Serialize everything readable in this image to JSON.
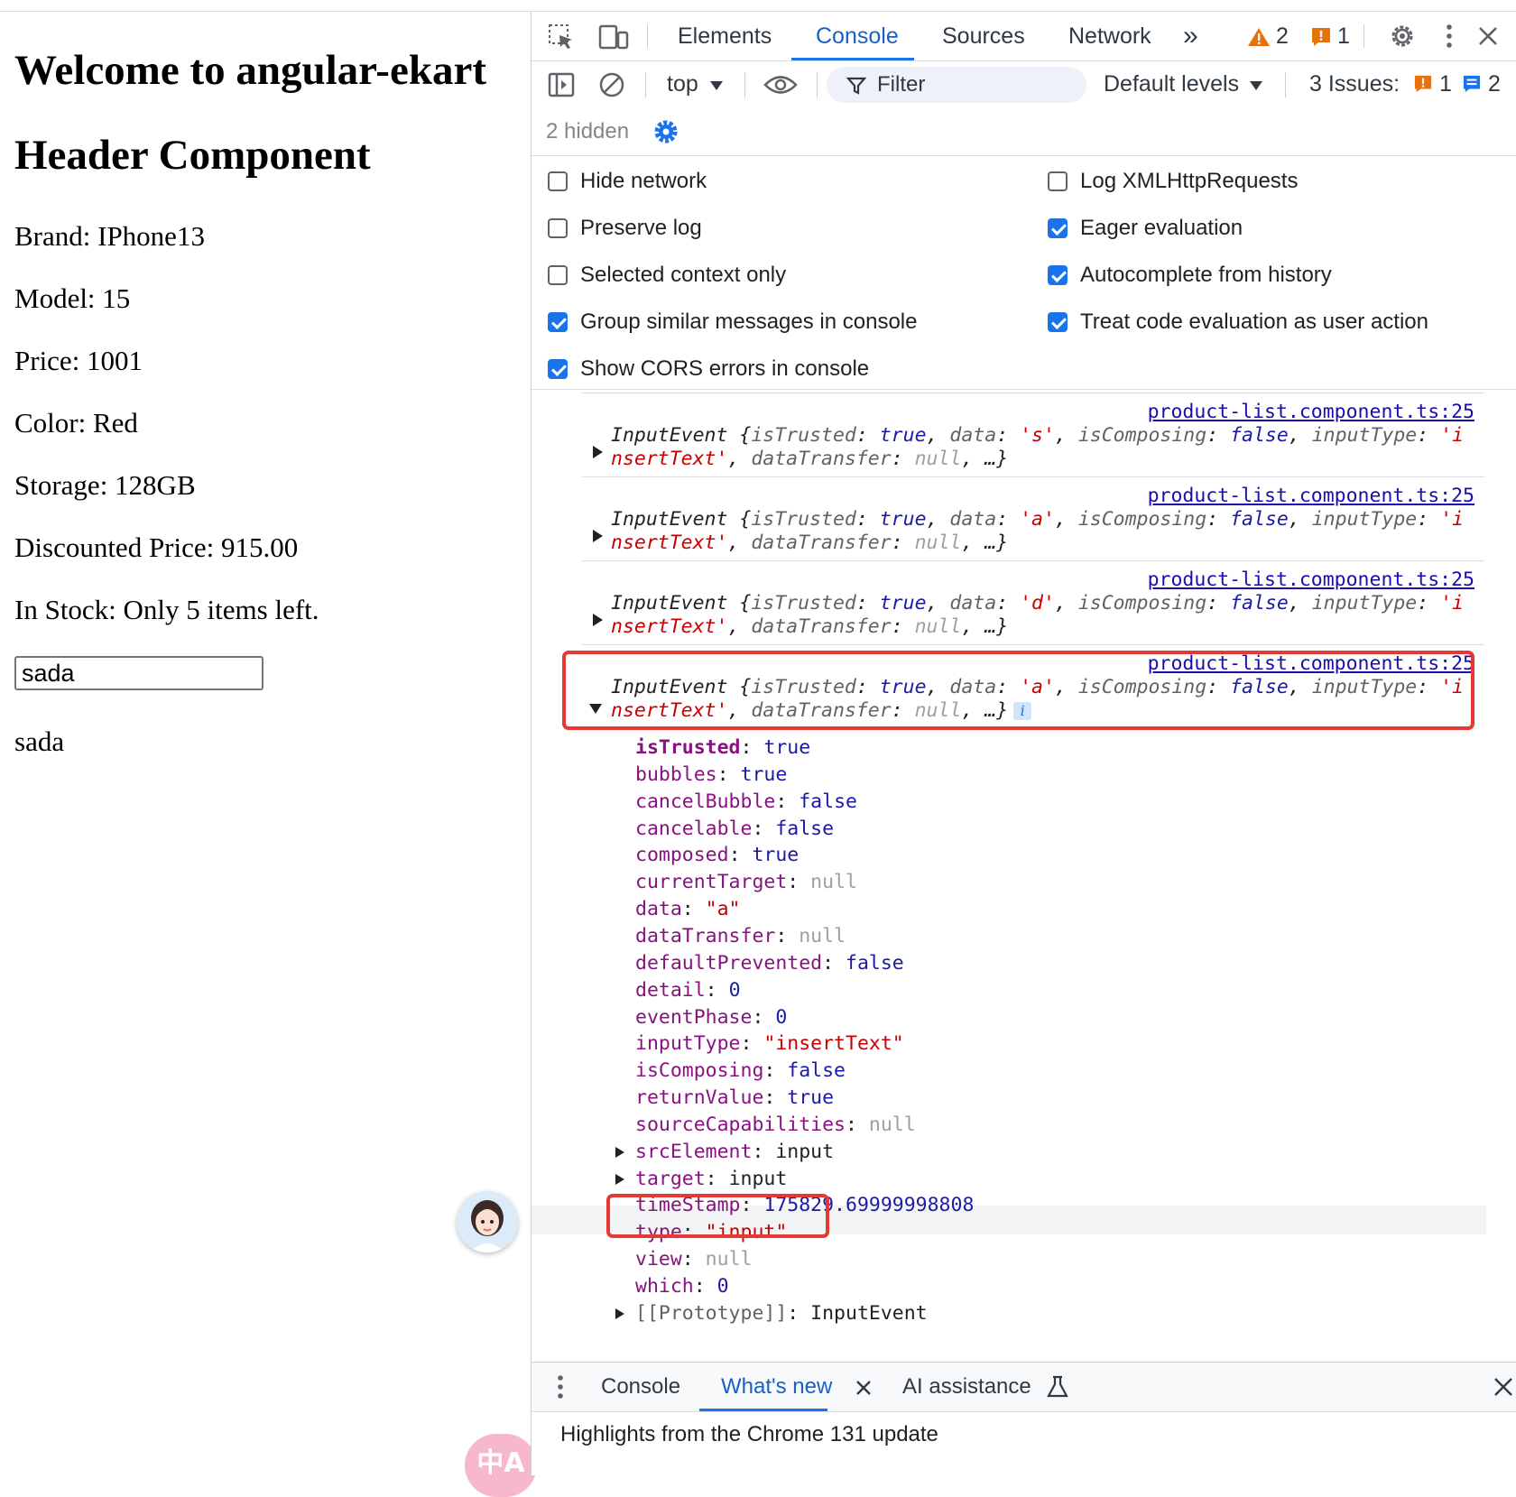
{
  "page": {
    "heading1": "Welcome to angular-ekart",
    "heading2": "Header Component",
    "brand": "Brand: IPhone13",
    "model": "Model: 15",
    "price": "Price: 1001",
    "color": "Color: Red",
    "storage": "Storage: 128GB",
    "discounted_price": "Discounted Price: 915.00",
    "in_stock": "In Stock: Only 5 items left.",
    "input_value": "sada",
    "echo_text": "sada",
    "translate_glyph": "中A"
  },
  "devtools": {
    "tabs": [
      "Elements",
      "Console",
      "Sources",
      "Network"
    ],
    "active_tab": "Console",
    "more_tabs": "»",
    "warnings_count": "2",
    "errors_count": "1",
    "toolbar": {
      "context": "top",
      "filter_placeholder": "Filter",
      "levels": "Default levels",
      "issues_label": "3 Issues:",
      "issues_errors": "1",
      "issues_info": "2",
      "hidden_label": "2 hidden"
    },
    "settings_left": [
      {
        "label": "Hide network",
        "checked": false
      },
      {
        "label": "Preserve log",
        "checked": false
      },
      {
        "label": "Selected context only",
        "checked": false
      },
      {
        "label": "Group similar messages in console",
        "checked": true
      },
      {
        "label": "Show CORS errors in console",
        "checked": true
      }
    ],
    "settings_right": [
      {
        "label": "Log XMLHttpRequests",
        "checked": false
      },
      {
        "label": "Eager evaluation",
        "checked": true
      },
      {
        "label": "Autocomplete from history",
        "checked": true
      },
      {
        "label": "Treat code evaluation as user action",
        "checked": true
      }
    ],
    "source_link": "product-list.component.ts:25",
    "messages": [
      {
        "data": "'s'",
        "expanded": false
      },
      {
        "data": "'a'",
        "expanded": false
      },
      {
        "data": "'d'",
        "expanded": false
      },
      {
        "data": "'a'",
        "expanded": true
      }
    ],
    "message_prefix": "InputEvent",
    "expanded_props": [
      {
        "key": "isTrusted",
        "value": "true",
        "kind": "bool",
        "bold": true
      },
      {
        "key": "bubbles",
        "value": "true",
        "kind": "bool"
      },
      {
        "key": "cancelBubble",
        "value": "false",
        "kind": "bool"
      },
      {
        "key": "cancelable",
        "value": "false",
        "kind": "bool"
      },
      {
        "key": "composed",
        "value": "true",
        "kind": "bool"
      },
      {
        "key": "currentTarget",
        "value": "null",
        "kind": "nul"
      },
      {
        "key": "data",
        "value": "\"a\"",
        "kind": "str"
      },
      {
        "key": "dataTransfer",
        "value": "null",
        "kind": "nul"
      },
      {
        "key": "defaultPrevented",
        "value": "false",
        "kind": "bool"
      },
      {
        "key": "detail",
        "value": "0",
        "kind": "num"
      },
      {
        "key": "eventPhase",
        "value": "0",
        "kind": "num"
      },
      {
        "key": "inputType",
        "value": "\"insertText\"",
        "kind": "str"
      },
      {
        "key": "isComposing",
        "value": "false",
        "kind": "bool"
      },
      {
        "key": "returnValue",
        "value": "true",
        "kind": "bool"
      },
      {
        "key": "sourceCapabilities",
        "value": "null",
        "kind": "nul"
      },
      {
        "key": "srcElement",
        "value": "input",
        "kind": "obj",
        "expandable": true
      },
      {
        "key": "target",
        "value": "input",
        "kind": "obj",
        "expandable": true
      },
      {
        "key": "timeStamp",
        "value": "175829.69999998808",
        "kind": "num"
      },
      {
        "key": "type",
        "value": "\"input\"",
        "kind": "str"
      },
      {
        "key": "view",
        "value": "null",
        "kind": "nul"
      },
      {
        "key": "which",
        "value": "0",
        "kind": "num"
      },
      {
        "key": "[[Prototype]]",
        "value": "InputEvent",
        "kind": "obj",
        "expandable": true,
        "proto": true
      }
    ],
    "drawer": {
      "tabs": [
        "Console",
        "What's new",
        "AI assistance"
      ],
      "active_tab": "What's new",
      "content": "Highlights from the Chrome 131 update"
    }
  },
  "colors": {
    "accent": "#1a73e8",
    "highlight_box": "#e53935",
    "warning": "#e8710a",
    "error": "#e8710a"
  }
}
